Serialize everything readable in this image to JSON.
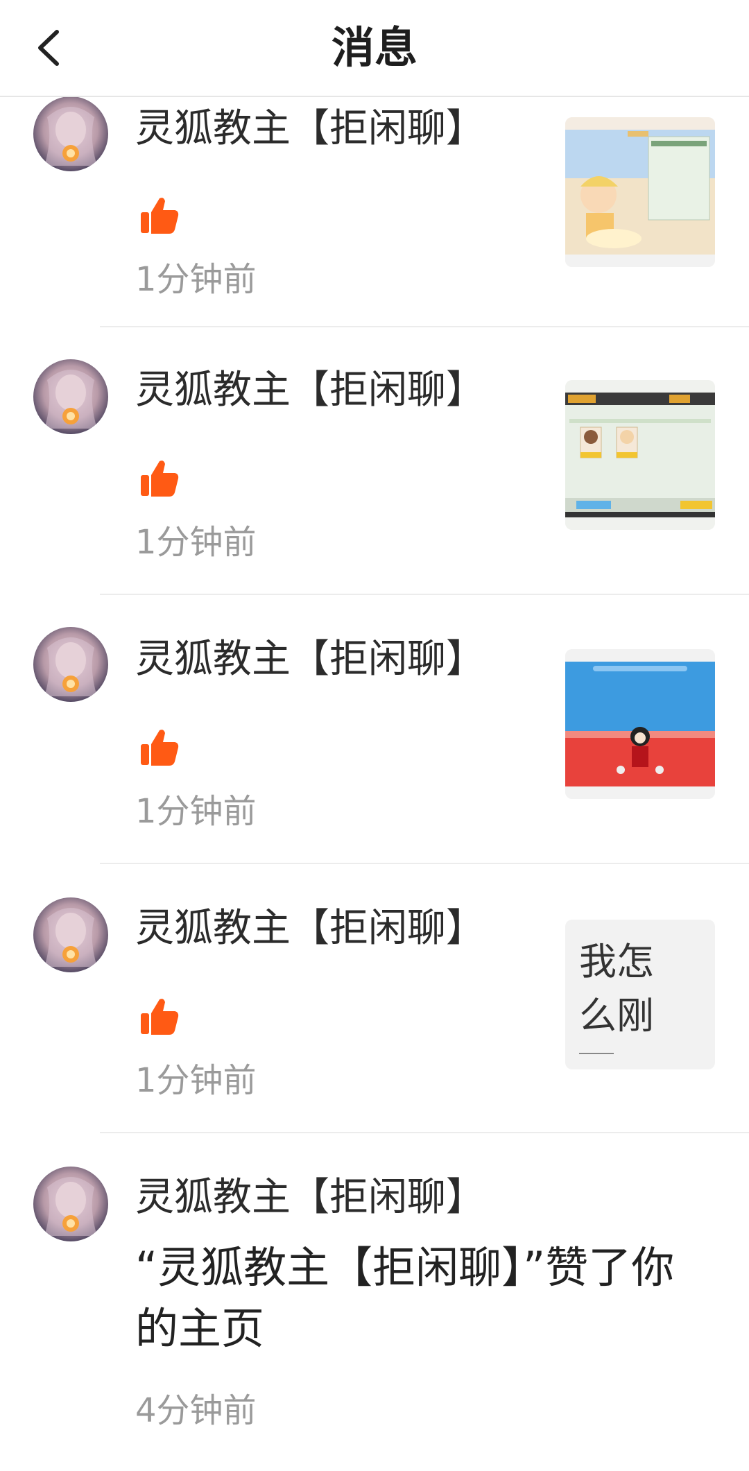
{
  "header": {
    "title": "消息",
    "back_icon": "chevron-left-icon"
  },
  "colors": {
    "like": "#ff5a14",
    "time": "#9a9a9a",
    "divider": "#ececec"
  },
  "items": [
    {
      "name": "灵狐教主【拒闲聊】",
      "icon": "thumbs-up-icon",
      "time": "1分钟前",
      "preview": "game-screenshot-cake"
    },
    {
      "name": "灵狐教主【拒闲聊】",
      "icon": "thumbs-up-icon",
      "time": "1分钟前",
      "preview": "game-screenshot-character-select"
    },
    {
      "name": "灵狐教主【拒闲聊】",
      "icon": "thumbs-up-icon",
      "time": "1分钟前",
      "preview": "game-screenshot-flower-field"
    },
    {
      "name": "灵狐教主【拒闲聊】",
      "icon": "thumbs-up-icon",
      "time": "1分钟前",
      "preview_text": "我怎么刚"
    },
    {
      "name": "灵狐教主【拒闲聊】",
      "message": "“灵狐教主【拒闲聊】”赞了你的主页",
      "time": "4分钟前"
    }
  ]
}
